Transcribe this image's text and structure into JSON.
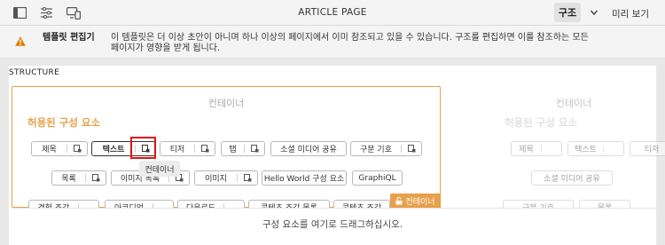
{
  "toolbar": {
    "page_title": "ARTICLE PAGE",
    "structure_label": "구조",
    "preview_label": "미리 보기",
    "icons": [
      "side-panel-icon",
      "page-properties-icon",
      "emulator-icon",
      "chevron-down-icon"
    ]
  },
  "alert": {
    "title": "템플릿 편집기",
    "message": "이 템플릿은 더 이상 초안이 아니며 하나 이상의 페이지에서 이미 참조되고 있을 수 있습니다. 구조를 편집하면 이를 참조하는 모든 페이지가 영향을 받게 됩니다.",
    "icon": "warning-icon",
    "icon_color": "#e07b00"
  },
  "structure": {
    "label": "STRUCTURE",
    "container_title": "컨테이너",
    "allowed_components_title": "허용된 구성 요소",
    "accent_color": "#e8a04a",
    "components_row1": [
      "제목",
      "텍스트",
      "티저",
      "탭",
      "소셜 미디어 공유",
      "구분 기호"
    ],
    "components_row2": [
      "목록",
      "이미지 목록",
      "이미지",
      "Hello World 구성 요소",
      "GraphiQL"
    ],
    "components_row3": [
      "경험 조각",
      "아코디언",
      "다운로드",
      "콘텐츠 조각 목록",
      "콘텐츠 조각"
    ],
    "tooltip": "컨테이너",
    "container_badge": "컨테이너",
    "highlight_color": "#e0150f"
  },
  "right_container": {
    "container_title": "컨테이너",
    "allowed_components_title": "허용된 구성 요소",
    "components_row1": [
      "제목",
      "텍스트",
      "티저"
    ],
    "components_row2": [
      "소셜 미디어 공유"
    ],
    "components_row3": [
      "구분 기호",
      "목록"
    ]
  },
  "dropzone": {
    "text": "구성 요소를 여기로 드래그하십시오."
  }
}
